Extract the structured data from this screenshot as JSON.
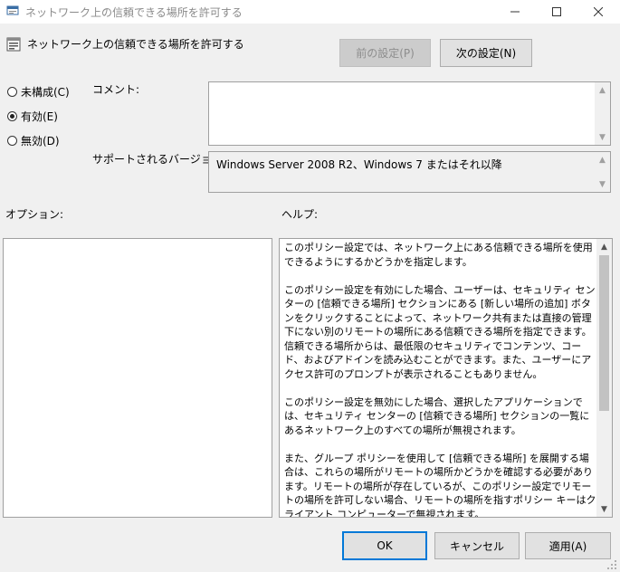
{
  "window": {
    "title": "ネットワーク上の信頼できる場所を許可する",
    "caption_buttons": {
      "minimize": "—",
      "maximize": "☐",
      "close": "✕"
    }
  },
  "header": {
    "title": "ネットワーク上の信頼できる場所を許可する",
    "prev_button": "前の設定(P)",
    "next_button": "次の設定(N)"
  },
  "state": {
    "options": [
      {
        "label": "未構成(C)",
        "selected": false
      },
      {
        "label": "有効(E)",
        "selected": true
      },
      {
        "label": "無効(D)",
        "selected": false
      }
    ]
  },
  "comment": {
    "label": "コメント:",
    "value": ""
  },
  "supported": {
    "label": "サポートされるバージョン:",
    "value": "Windows Server 2008 R2、Windows 7 またはそれ以降"
  },
  "options_panel": {
    "label": "オプション:"
  },
  "help_panel": {
    "label": "ヘルプ:",
    "text": "このポリシー設定では、ネットワーク上にある信頼できる場所を使用できるようにするかどうかを指定します。\n\nこのポリシー設定を有効にした場合、ユーザーは、セキュリティ センターの [信頼できる場所] セクションにある [新しい場所の追加] ボタンをクリックすることによって、ネットワーク共有または直接の管理下にない別のリモートの場所にある信頼できる場所を指定できます。信頼できる場所からは、最低限のセキュリティでコンテンツ、コード、およびアドインを読み込むことができます。また、ユーザーにアクセス許可のプロンプトが表示されることもありません。\n\nこのポリシー設定を無効にした場合、選択したアプリケーションでは、セキュリティ センターの [信頼できる場所] セクションの一覧にあるネットワーク上のすべての場所が無視されます。\n\nまた、グループ ポリシーを使用して [信頼できる場所] を展開する場合は、これらの場所がリモートの場所かどうかを確認する必要があります。リモートの場所が存在しているが、このポリシー設定でリモートの場所を許可しない場合、リモートの場所を指すポリシー キーはクライアント コンピューターで無視されます。"
  },
  "footer": {
    "ok": "OK",
    "cancel": "キャンセル",
    "apply": "適用(A)"
  },
  "colors": {
    "accent": "#0078d7",
    "background": "#f0f0f0"
  }
}
